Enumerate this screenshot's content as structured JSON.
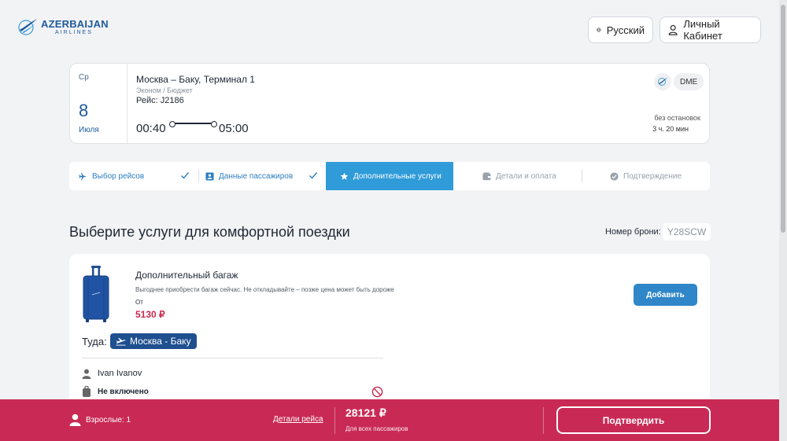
{
  "header": {
    "logo_main": "AZERBAIJAN",
    "logo_sub": "AIRLINES",
    "language_label": "Русский",
    "cabinet_label": "Личный Кабинет"
  },
  "flight": {
    "weekday": "Ср",
    "day": "8",
    "month": "Июля",
    "route": "Москва – Баку, Терминал 1",
    "fare_class": "Эконом / Бюджет",
    "flight_number": "Рейс: J2186",
    "departure_time": "00:40",
    "arrival_time": "05:00",
    "airport_code": "DME",
    "stops": "без остановок",
    "duration": "3 ч. 20 мин"
  },
  "stepper": {
    "steps": [
      {
        "label": "Выбор рейсов",
        "state": "done"
      },
      {
        "label": "Данные пассажиров",
        "state": "done"
      },
      {
        "label": "Дополнительные услуги",
        "state": "active"
      },
      {
        "label": "Детали и оплата",
        "state": "todo"
      },
      {
        "label": "Подтверждение",
        "state": "todo"
      }
    ]
  },
  "main": {
    "title": "Выберите услуги для комфортной поездки",
    "booking_label": "Номер брони:",
    "booking_number": "Y28SCW"
  },
  "baggage": {
    "title": "Дополнительный багаж",
    "description": "Выгоднее приобрести багаж сейчас. Не откладывайте – позже цена может быть дороже",
    "from_label": "От",
    "price": "5130 ₽",
    "add_label": "Добавить",
    "direction_label": "Туда:",
    "direction_route": "Москва - Баку",
    "passenger_name": "Ivan Ivanov",
    "status": "Не включено"
  },
  "footer": {
    "adults": "Взрослые: 1",
    "details_link": "Детали рейса",
    "total": "28121 ₽",
    "total_note": "Для всех пассажиров",
    "confirm_label": "Подтвердить"
  },
  "colors": {
    "accent": "#2f9bd8",
    "brand": "#1e5a9c",
    "footer": "#c92a55",
    "price": "#c9284f"
  }
}
